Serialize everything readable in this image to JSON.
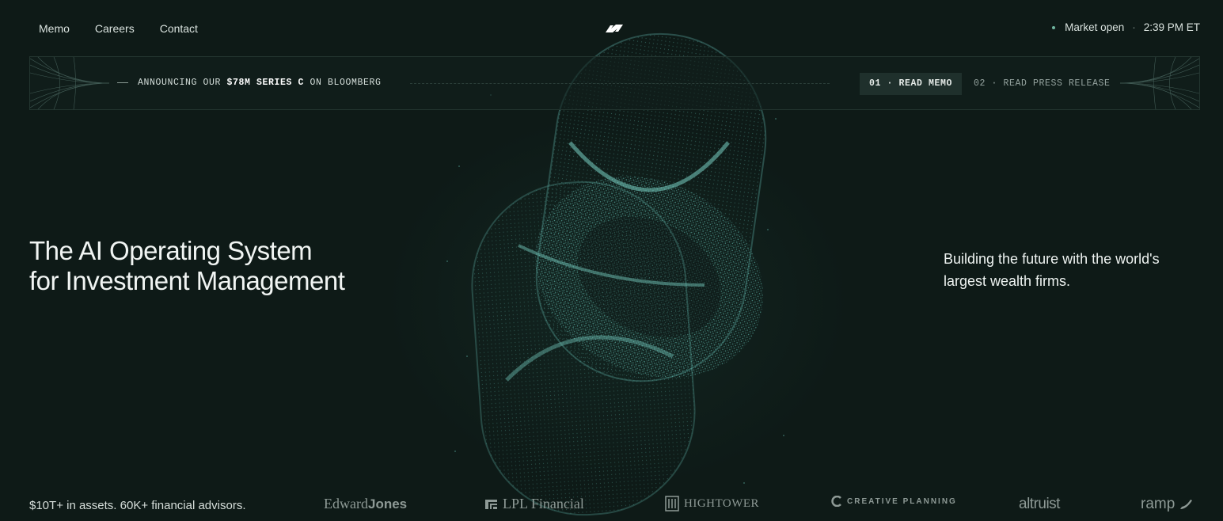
{
  "nav": {
    "links": [
      "Memo",
      "Careers",
      "Contact"
    ],
    "market_status": "Market open",
    "time": "2:39 PM ET"
  },
  "banner": {
    "announce_prefix": "ANNOUNCING OUR ",
    "announce_amount": "$78M SERIES C",
    "announce_suffix": " ON BLOOMBERG",
    "memo_label": "01 · READ MEMO",
    "press_label": "02 · READ PRESS RELEASE"
  },
  "hero": {
    "headline_line1": "The AI Operating System",
    "headline_line2": "for Investment Management",
    "sub_line1": "Building the future with the world's",
    "sub_line2": "largest wealth firms."
  },
  "footer": {
    "stats": "$10T+ in assets. 60K+ financial advisors.",
    "logos": {
      "edward_a": "Edward",
      "edward_b": "Jones",
      "lpl": "LPL Financial",
      "hightower": "HIGHTOWER",
      "creative": "CREATIVE PLANNING",
      "altruist": "altruist",
      "ramp": "ramp"
    }
  },
  "colors": {
    "background": "#0e1a17",
    "accent_teal": "#5fb3a8",
    "banner_border": "#233530"
  }
}
